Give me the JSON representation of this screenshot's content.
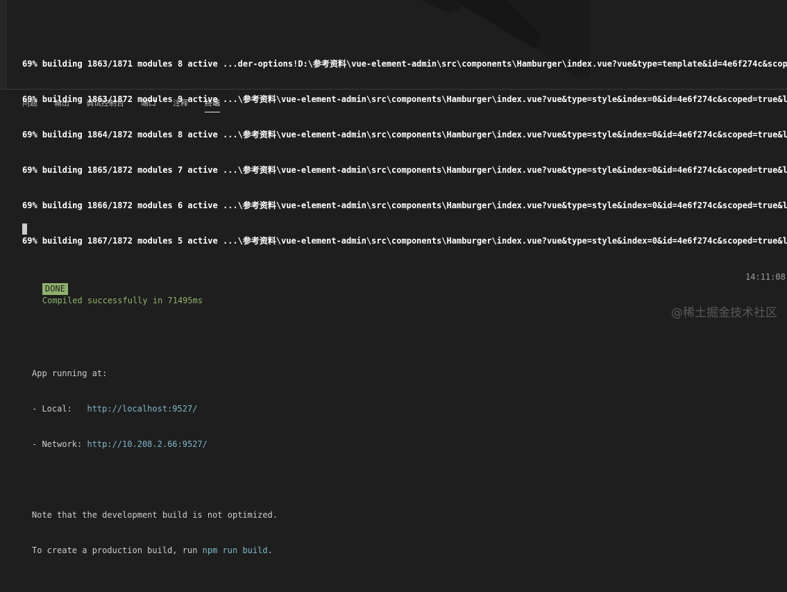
{
  "panel": {
    "tabs": [
      {
        "label": "问题"
      },
      {
        "label": "输出"
      },
      {
        "label": "调试控制台"
      },
      {
        "label": "端口"
      },
      {
        "label": "注释"
      },
      {
        "label": "终端"
      }
    ],
    "active_tab": "终端"
  },
  "terminal": {
    "build_lines": [
      "69% building 1863/1871 modules 8 active ...der-options!D:\\参考资料\\vue-element-admin\\src\\components\\Hamburger\\index.vue?vue&type=template&id=4e6f274c&scoped=t",
      "69% building 1863/1872 modules 9 active ...\\参考资料\\vue-element-admin\\src\\components\\Hamburger\\index.vue?vue&type=style&index=0&id=4e6f274c&scoped=true&lang-",
      "69% building 1864/1872 modules 8 active ...\\参考资料\\vue-element-admin\\src\\components\\Hamburger\\index.vue?vue&type=style&index=0&id=4e6f274c&scoped=true&lang-",
      "69% building 1865/1872 modules 7 active ...\\参考资料\\vue-element-admin\\src\\components\\Hamburger\\index.vue?vue&type=style&index=0&id=4e6f274c&scoped=true&lang-",
      "69% building 1866/1872 modules 6 active ...\\参考资料\\vue-element-admin\\src\\components\\Hamburger\\index.vue?vue&type=style&index=0&id=4e6f274c&scoped=true&lang-",
      "69% building 1867/1872 modules 5 active ...\\参考资料\\vue-element-admin\\src\\components\\Hamburger\\index.vue?vue&type=style&index=0&id=4e6f274c&scoped=true&lang-"
    ],
    "done_badge": "DONE",
    "done_message": "Compiled successfully in 71495ms",
    "done_time": "14:11:08",
    "app_running": "App running at:",
    "local_label": "- Local:   ",
    "local_url": "http://localhost:9527/",
    "network_label": "- Network: ",
    "network_url": "http://10.208.2.66:9527/",
    "note_line": "Note that the development build is not optimized.",
    "prod_prefix": "To create a production build, run ",
    "prod_cmd": "npm run build",
    "prod_suffix": "."
  },
  "watermark": "@稀土掘金技术社区",
  "colors": {
    "background": "#1e1e1e",
    "done_badge_bg": "#8fb26b",
    "link": "#7fb7c9"
  }
}
